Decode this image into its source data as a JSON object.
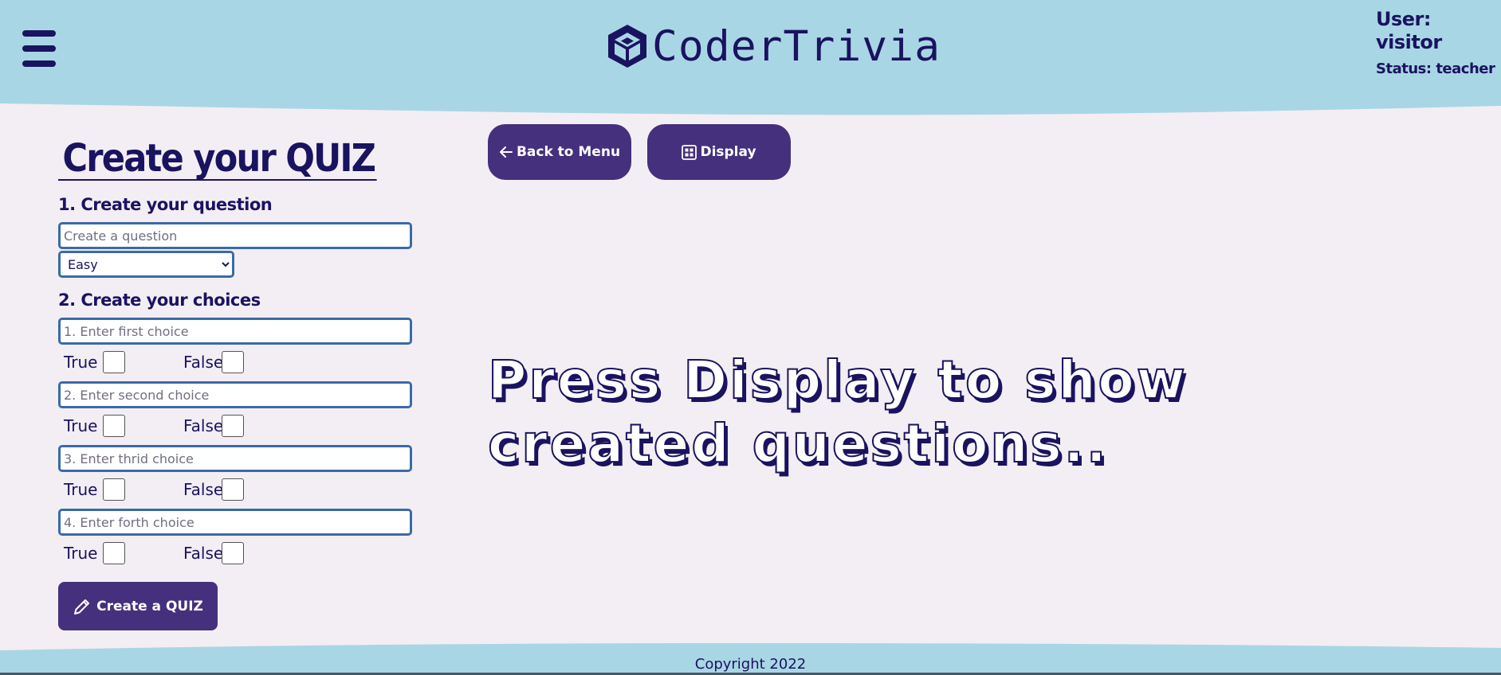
{
  "colors": {
    "header_bg": "#a9d6e5",
    "page_bg": "#f3eef3",
    "brand_navy": "#1a1360",
    "button_purple": "#45307d",
    "input_border": "#3a6aa8"
  },
  "header": {
    "menu_icon": "hamburger-menu-icon",
    "logo_icon": "cube-logo-icon",
    "app_name": "CoderTrivia",
    "user_label": "User:",
    "user_name": "visitor",
    "status_text": "Status: teacher"
  },
  "form": {
    "title": "Create your QUIZ",
    "step1_title": "1. Create your question",
    "question_placeholder": "Create a question",
    "difficulty": {
      "selected": "Easy"
    },
    "step2_title": "2. Create your choices",
    "choices": [
      {
        "placeholder": "1. Enter first choice",
        "true_label": "True",
        "false_label": "False"
      },
      {
        "placeholder": "2. Enter second choice",
        "true_label": "True",
        "false_label": "False"
      },
      {
        "placeholder": "3. Enter thrid choice",
        "true_label": "True",
        "false_label": "False"
      },
      {
        "placeholder": "4. Enter forth choice",
        "true_label": "True",
        "false_label": "False"
      }
    ],
    "create_button": {
      "icon": "pencil-icon",
      "label": "Create a QUIZ"
    }
  },
  "actions": {
    "back_button": {
      "icon": "arrow-left-icon",
      "label": "Back to Menu"
    },
    "display_button": {
      "icon": "grid-icon",
      "label": "Display"
    }
  },
  "main": {
    "empty_message": "Press Display to show created questions.."
  },
  "footer": {
    "copyright": "Copyright 2022"
  }
}
